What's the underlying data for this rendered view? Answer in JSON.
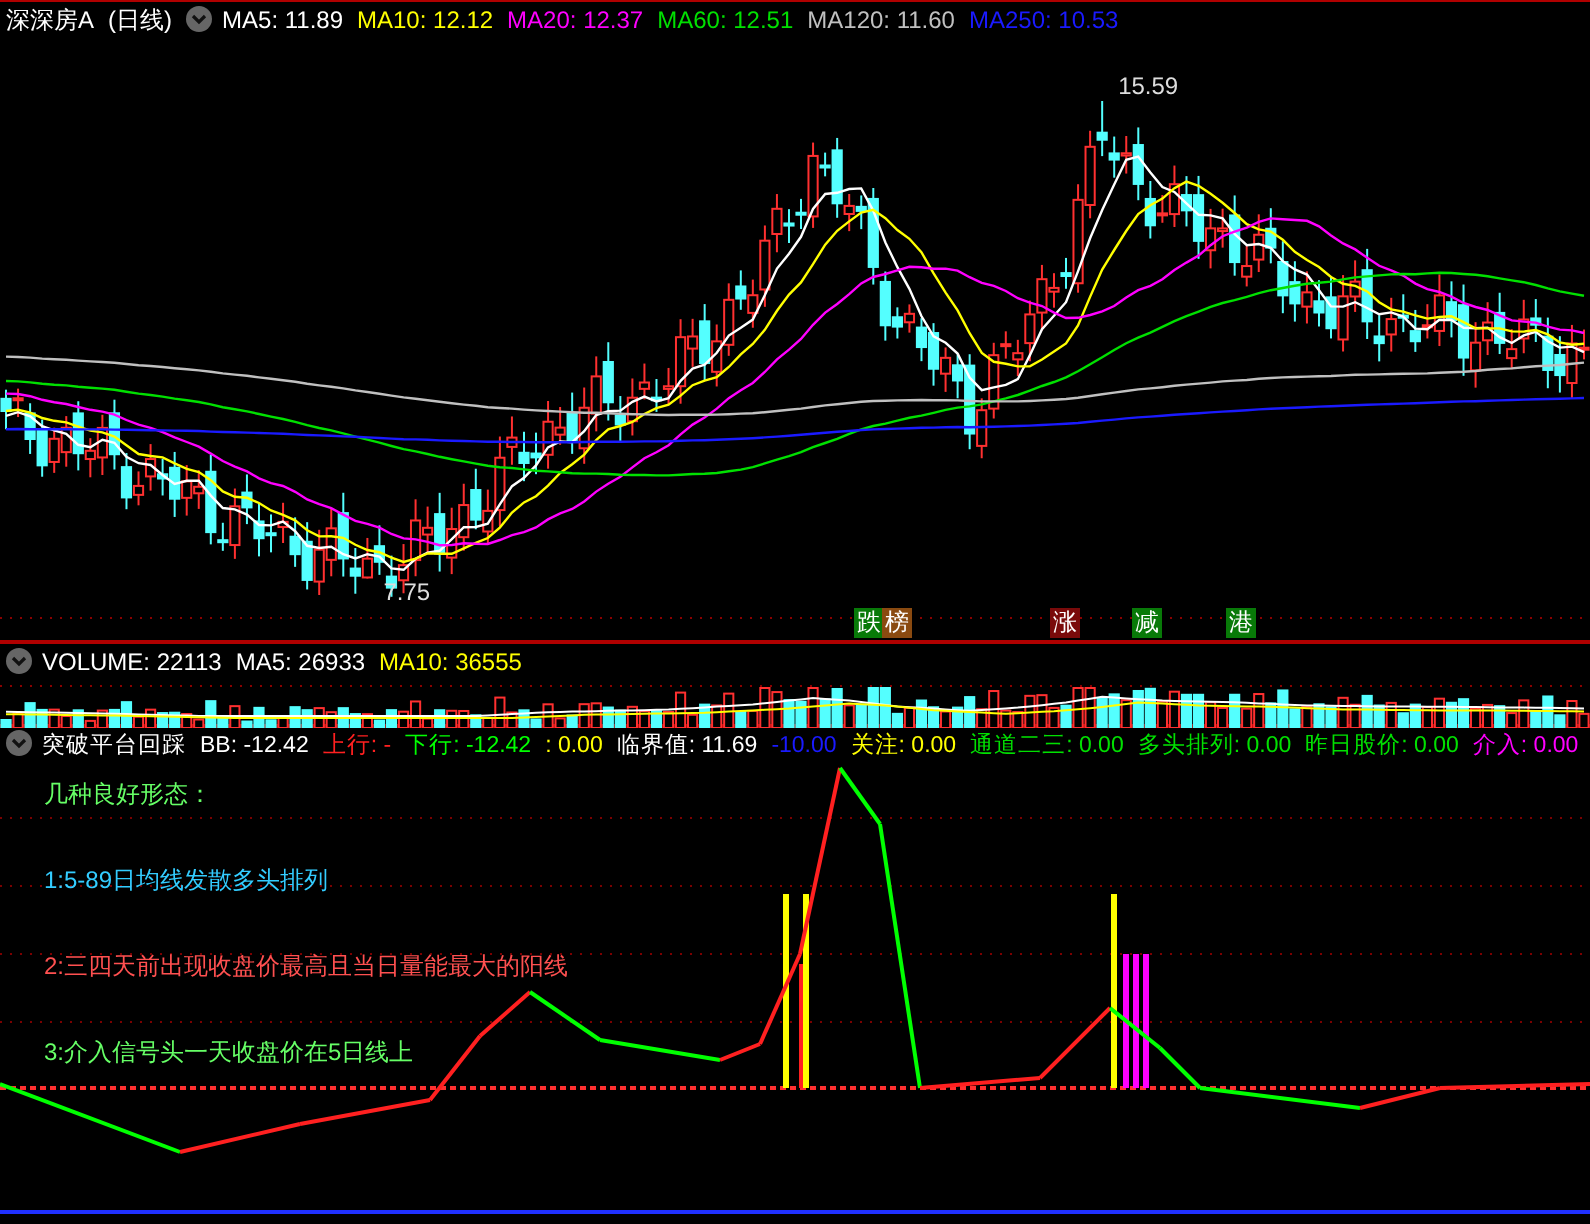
{
  "main_pane": {
    "title": "深深房A",
    "period": "(日线)",
    "readouts": [
      {
        "text": "MA5: 11.89",
        "color": "#ffffff"
      },
      {
        "text": "MA10: 12.12",
        "color": "#ffff00"
      },
      {
        "text": "MA20: 12.37",
        "color": "#ff00ff"
      },
      {
        "text": "MA60: 12.51",
        "color": "#00e000"
      },
      {
        "text": "MA120: 11.60",
        "color": "#c0c0c0"
      },
      {
        "text": "MA250: 10.53",
        "color": "#1a1aff"
      }
    ],
    "high_marker": "15.59",
    "low_marker": "7.75",
    "signal_tags": [
      {
        "text": "跌",
        "color": "#087a08"
      },
      {
        "text": "榜",
        "color": "#8a4a10"
      },
      {
        "text": "涨",
        "color": "#7a0a0a"
      },
      {
        "text": "减",
        "color": "#087a08"
      },
      {
        "text": "港",
        "color": "#087a08"
      }
    ]
  },
  "volume_pane": {
    "readouts": [
      {
        "text": "VOLUME: 22113",
        "color": "#ffffff"
      },
      {
        "text": "MA5: 26933",
        "color": "#ffffff"
      },
      {
        "text": "MA10: 36555",
        "color": "#ffff00"
      }
    ]
  },
  "indicator_pane": {
    "title": "突破平台回踩",
    "readouts": [
      {
        "text": "BB: -12.42",
        "color": "#ffffff"
      },
      {
        "text": "上行: -",
        "color": "#ff2020"
      },
      {
        "text": "下行: -12.42",
        "color": "#00ff00"
      },
      {
        "text": ": 0.00",
        "color": "#ffff00"
      },
      {
        "text": "临界值: 11.69",
        "color": "#ffffff"
      },
      {
        "text": "-10.00",
        "color": "#1a1aff"
      },
      {
        "text": "关注: 0.00",
        "color": "#ffff00"
      },
      {
        "text": "通道二三: 0.00",
        "color": "#00e000"
      },
      {
        "text": "多头排列: 0.00",
        "color": "#00e000"
      },
      {
        "text": "昨日股价: 0.00",
        "color": "#00e000"
      },
      {
        "text": "介入: 0.00",
        "color": "#ff00ff"
      }
    ],
    "notes": [
      {
        "text": "几种良好形态：",
        "color": "#66ff66"
      },
      {
        "text": "1:5-89日均线发散多头排列",
        "color": "#33ccff"
      },
      {
        "text": "2:三四天前出现收盘价最高且当日量能最大的阳线",
        "color": "#ff5050"
      },
      {
        "text": "3:介入信号头一天收盘价在5日线上",
        "color": "#66ff66"
      }
    ]
  }
}
